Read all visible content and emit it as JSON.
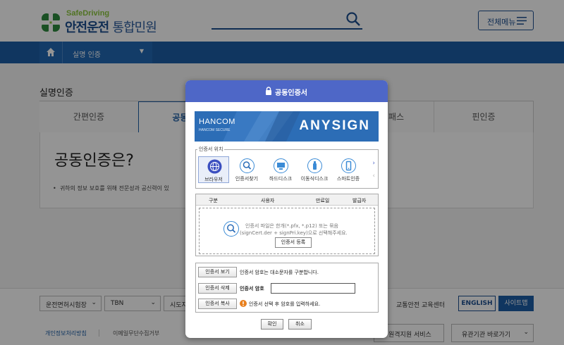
{
  "header": {
    "logo_top": "SafeDriving",
    "logo_main": "안전운전",
    "logo_sub": "통합민원",
    "menu_label": "전체메뉴"
  },
  "navbar": {
    "crumb": "실명 인증"
  },
  "content": {
    "title": "실명인증",
    "tabs": [
      "간편인증",
      "공동인증",
      "",
      "아이핀패스",
      "핀인증"
    ],
    "heading": "공동인증은?",
    "bullet": "귀하의 정보 보호를 위해 전문성과 공신력이 있"
  },
  "footer": {
    "selects": [
      "운전면허시험장",
      "TBN",
      "시도지"
    ],
    "link": "교통안전 교육센터",
    "english": "ENGLISH",
    "sitemap": "사이트맵",
    "bottom_links": [
      "개인정보처리방침",
      "이메일무단수집거부"
    ],
    "remote": "원격지원 서비스",
    "related": "유관기관 바로가기"
  },
  "modal": {
    "title": "공동인증서",
    "brand": "HANCOM",
    "brand_sub": "HANCOM SECURE",
    "product": "ANYSIGN",
    "location_legend": "인증서 위치",
    "locations": [
      "브라우저",
      "인증서찾기",
      "하드디스크",
      "이동식디스크",
      "스마트인증"
    ],
    "table_headers": [
      "구분",
      "사용자",
      "만료일",
      "발급자"
    ],
    "hint_line1": "인증서 파일은 한개(*.pfx, *.p12) 또는 묶음",
    "hint_line2": "(signCert.der + signPri.key)으로 선택해주세요.",
    "register": "인증서 등록",
    "view_btn": "인증서 보기",
    "view_text": "인증서 암호는 대소문자를 구분합니다.",
    "delete_btn": "인증서 삭제",
    "pw_label": "인증서 암호",
    "copy_btn": "인증서 복사",
    "copy_text": "인증서 선택 후 암호를 입력하세요.",
    "ok": "확인",
    "cancel": "취소"
  },
  "colors": {
    "primary": "#1d5ea6",
    "modal_header": "#4e67c7",
    "logo_green": "#8cc63f"
  }
}
